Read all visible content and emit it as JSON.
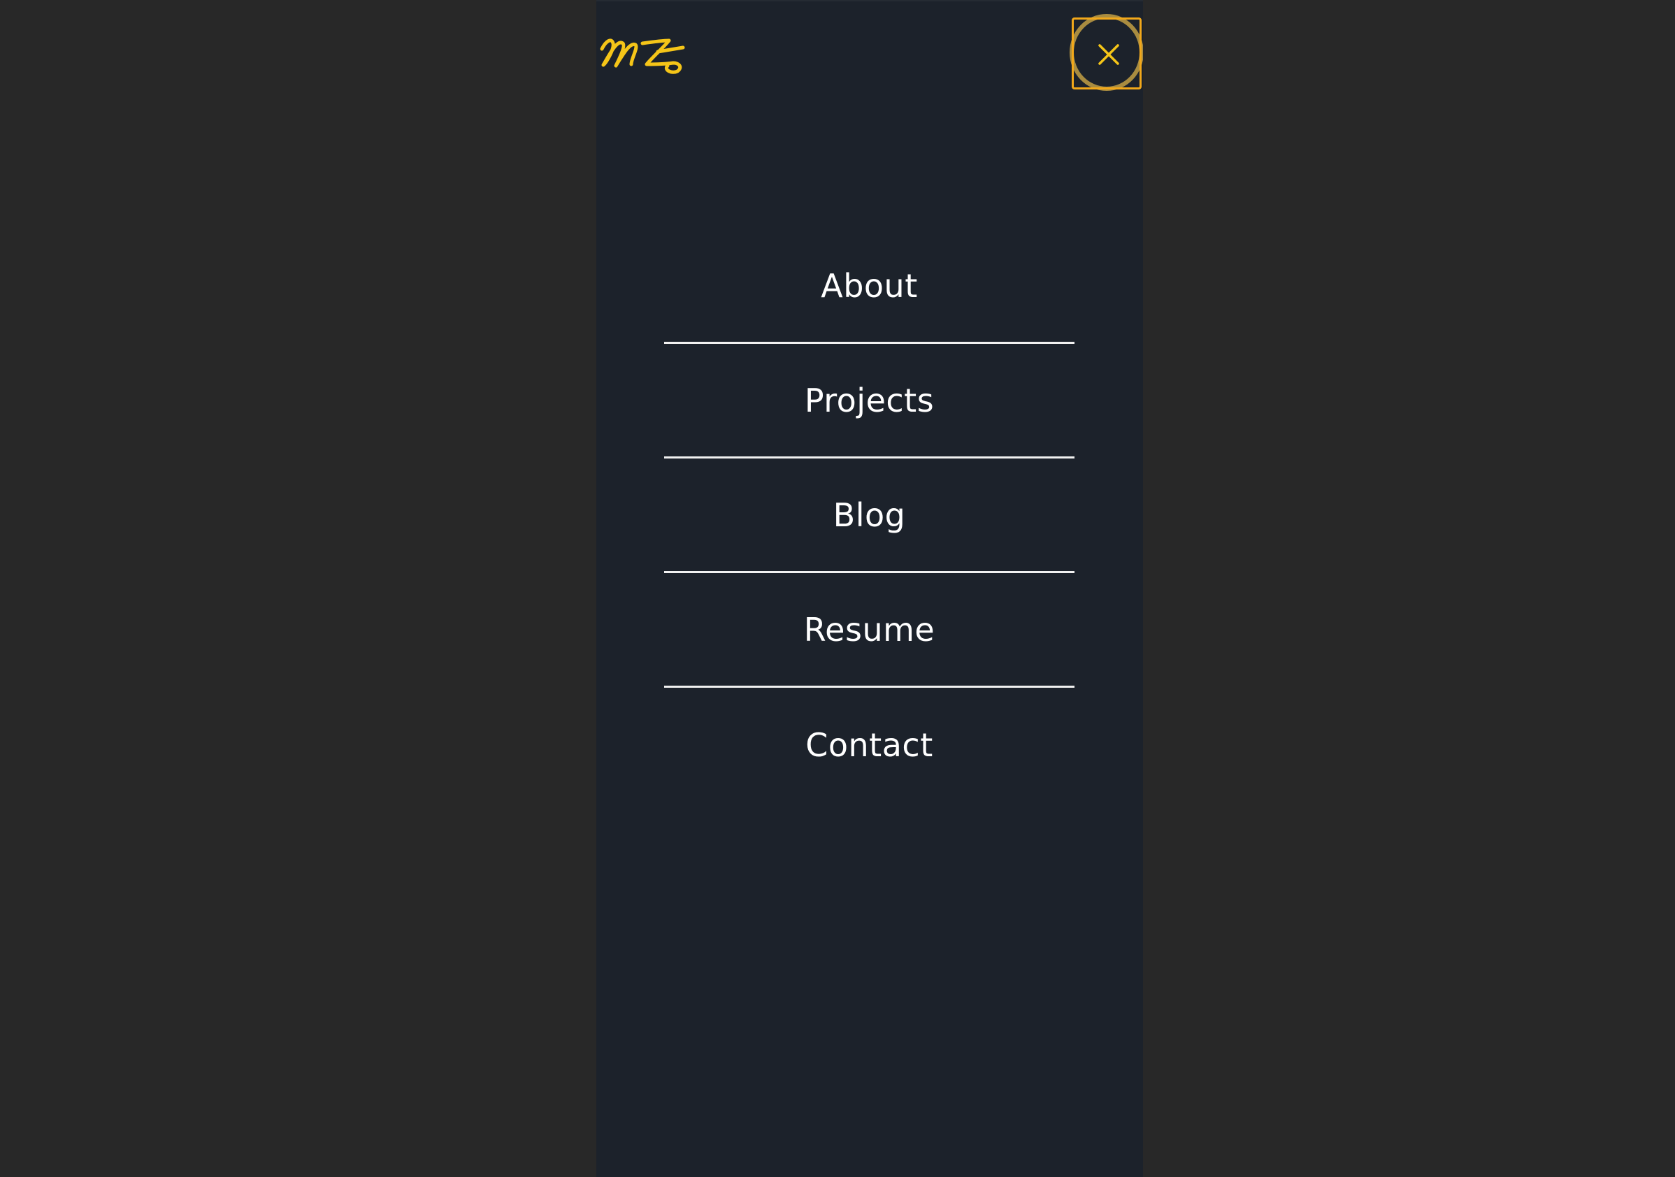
{
  "logo": {
    "text": "MZ",
    "color": "#f5c518"
  },
  "header": {
    "close_icon": "close-icon"
  },
  "menu": {
    "items": [
      {
        "label": "About"
      },
      {
        "label": "Projects"
      },
      {
        "label": "Blog"
      },
      {
        "label": "Resume"
      },
      {
        "label": "Contact"
      }
    ]
  },
  "colors": {
    "page_background": "#282828",
    "panel_background": "#1c222b",
    "accent": "#f5c518",
    "focus_border": "#f2a81a",
    "text": "#ffffff",
    "divider": "#f1f1f1"
  }
}
